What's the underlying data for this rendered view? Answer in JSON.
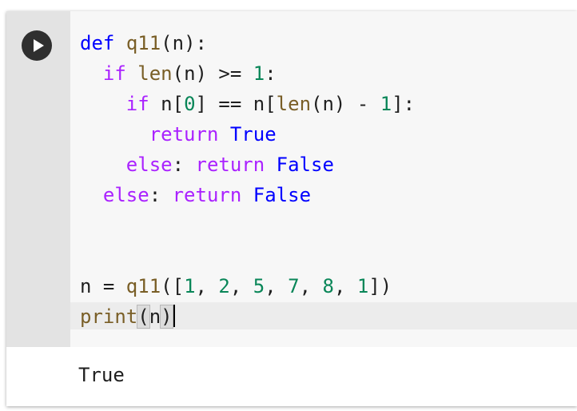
{
  "cell": {
    "run_button_icon": "play-icon",
    "code_lines": [
      [
        {
          "t": "def",
          "c": "kw-def"
        },
        {
          "t": " "
        },
        {
          "t": "q11",
          "c": "fn"
        },
        {
          "t": "(n):"
        }
      ],
      [
        {
          "t": "  "
        },
        {
          "t": "if",
          "c": "kw"
        },
        {
          "t": " "
        },
        {
          "t": "len",
          "c": "fn"
        },
        {
          "t": "(n) >= "
        },
        {
          "t": "1",
          "c": "num"
        },
        {
          "t": ":"
        }
      ],
      [
        {
          "t": "    "
        },
        {
          "t": "if",
          "c": "kw"
        },
        {
          "t": " n["
        },
        {
          "t": "0",
          "c": "num"
        },
        {
          "t": "] == n["
        },
        {
          "t": "len",
          "c": "fn"
        },
        {
          "t": "(n) - "
        },
        {
          "t": "1",
          "c": "num"
        },
        {
          "t": "]:"
        }
      ],
      [
        {
          "t": "      "
        },
        {
          "t": "return",
          "c": "kw"
        },
        {
          "t": " "
        },
        {
          "t": "True",
          "c": "const"
        }
      ],
      [
        {
          "t": "    "
        },
        {
          "t": "else",
          "c": "kw"
        },
        {
          "t": ": "
        },
        {
          "t": "return",
          "c": "kw"
        },
        {
          "t": " "
        },
        {
          "t": "False",
          "c": "const"
        }
      ],
      [
        {
          "t": "  "
        },
        {
          "t": "else",
          "c": "kw"
        },
        {
          "t": ": "
        },
        {
          "t": "return",
          "c": "kw"
        },
        {
          "t": " "
        },
        {
          "t": "False",
          "c": "const"
        }
      ],
      [],
      [],
      [
        {
          "t": "n = "
        },
        {
          "t": "q11",
          "c": "fn"
        },
        {
          "t": "(["
        },
        {
          "t": "1",
          "c": "num"
        },
        {
          "t": ", "
        },
        {
          "t": "2",
          "c": "num"
        },
        {
          "t": ", "
        },
        {
          "t": "5",
          "c": "num"
        },
        {
          "t": ", "
        },
        {
          "t": "7",
          "c": "num"
        },
        {
          "t": ", "
        },
        {
          "t": "8",
          "c": "num"
        },
        {
          "t": ", "
        },
        {
          "t": "1",
          "c": "num"
        },
        {
          "t": "])"
        }
      ],
      [
        {
          "t": "print",
          "c": "fn"
        },
        {
          "t": "(",
          "c": "br"
        },
        {
          "t": "n"
        },
        {
          "t": ")",
          "c": "br"
        },
        {
          "cursor": true
        }
      ]
    ],
    "output_text": "True"
  },
  "colors": {
    "keyword": "#aa22ff",
    "def_keyword": "#0000ff",
    "function": "#795e26",
    "number": "#098658",
    "constant": "#0000ff"
  }
}
